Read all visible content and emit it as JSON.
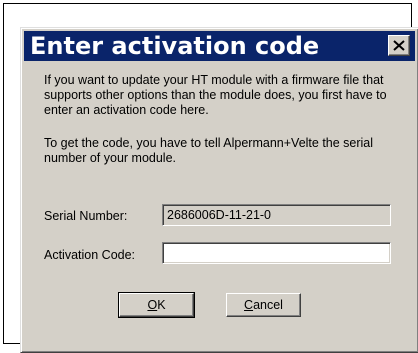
{
  "window": {
    "title": "Enter activation code",
    "close_icon": "close-icon"
  },
  "body": {
    "para1": "If you want to update your HT module with a firmware file that supports other options than the module does, you first have to enter an activation code here.",
    "para2": "To get the code, you have to tell Alpermann+Velte the serial number of your module."
  },
  "form": {
    "serial_label": "Serial Number:",
    "serial_value": "2686006D-11-21-0",
    "activation_label": "Activation Code:",
    "activation_value": ""
  },
  "buttons": {
    "ok_accel": "O",
    "ok_rest": "K",
    "cancel_accel": "C",
    "cancel_rest": "ancel"
  },
  "colors": {
    "titlebar": "#0a246a",
    "dialog_face": "#d4d0c8",
    "title_text": "#ffffff"
  }
}
